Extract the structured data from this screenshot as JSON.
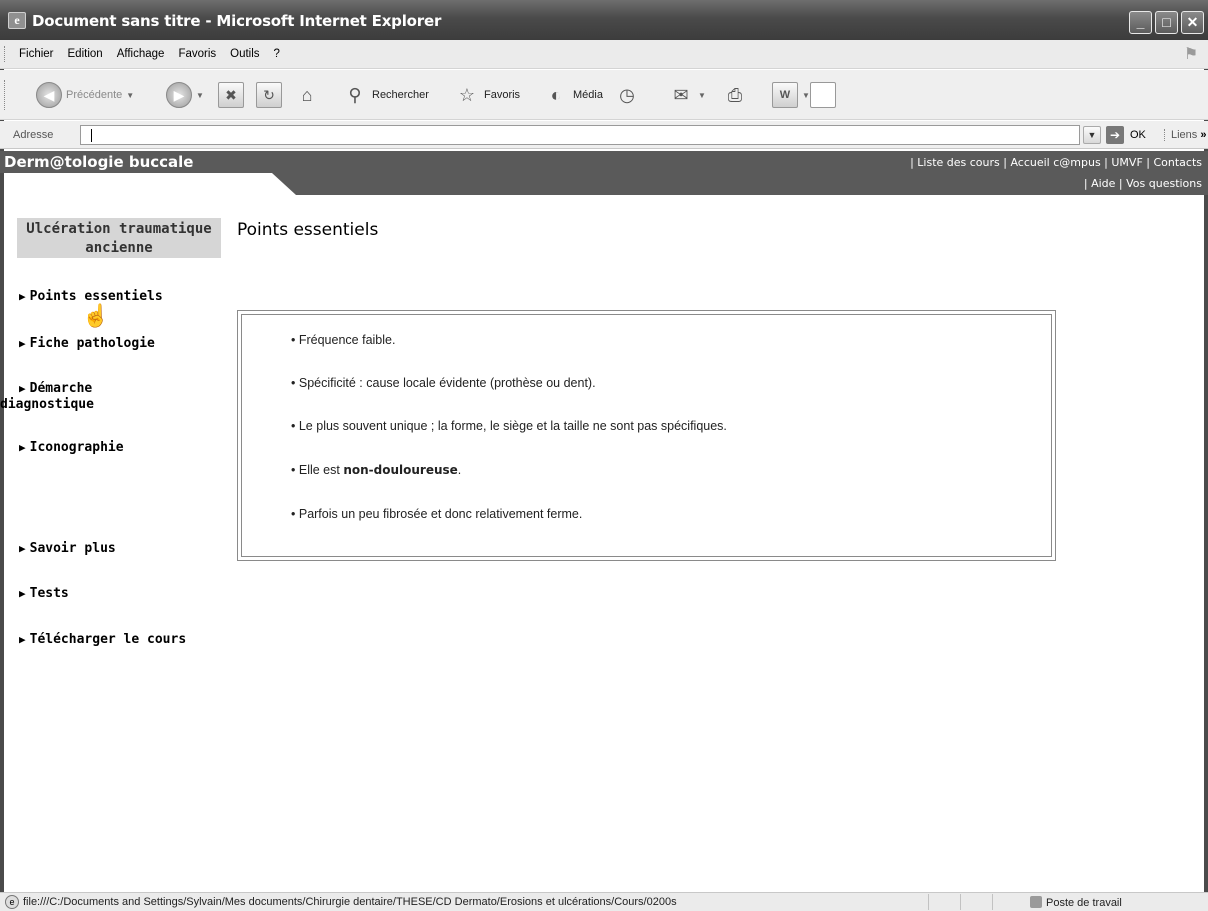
{
  "window": {
    "title": "Document sans titre - Microsoft Internet Explorer",
    "icon": "ie-page-icon",
    "controls": [
      "minimize-icon",
      "maximize-icon",
      "close-icon"
    ]
  },
  "menubar": {
    "items": [
      "Fichier",
      "Edition",
      "Affichage",
      "Favoris",
      "Outils",
      "?"
    ]
  },
  "toolbar": {
    "back_label": "Précédente",
    "search_label": "Rechercher",
    "favorites_label": "Favoris",
    "media_label": "Média"
  },
  "addressbar": {
    "label": "Adresse",
    "value": "",
    "go_label": "OK",
    "links_label": "Liens",
    "links_more": "»"
  },
  "site": {
    "title": "Derm@tologie buccale",
    "top_links": "| Liste des cours | Accueil c@mpus | UMVF | Contacts",
    "sub_links": "| Aide | Vos questions"
  },
  "nav": {
    "heading": "Ulcération traumatique ancienne",
    "items": [
      {
        "label": "Points essentiels"
      },
      {
        "label": "Fiche pathologie"
      },
      {
        "label": "Démarche",
        "label2": "diagnostique"
      },
      {
        "label": "Iconographie"
      },
      {
        "label": "Savoir plus"
      },
      {
        "label": "Tests"
      },
      {
        "label": "Télécharger le cours"
      }
    ]
  },
  "content": {
    "title": "Points essentiels",
    "bullets": [
      {
        "text": "Fréquence faible."
      },
      {
        "text": "Spécificité : cause locale évidente (prothèse ou dent)."
      },
      {
        "text": "Le plus souvent unique ; la forme, le siège et la taille ne sont pas spécifiques."
      },
      {
        "prefix": "Elle est ",
        "bold": "non-douloureuse",
        "suffix": "."
      },
      {
        "text": "Parfois un peu fibrosée et donc relativement ferme."
      }
    ]
  },
  "statusbar": {
    "url": "file:///C:/Documents and Settings/Sylvain/Mes documents/Chirurgie dentaire/THESE/CD Dermato/Erosions et ulcérations/Cours/0200s",
    "zone": "Poste de travail"
  }
}
